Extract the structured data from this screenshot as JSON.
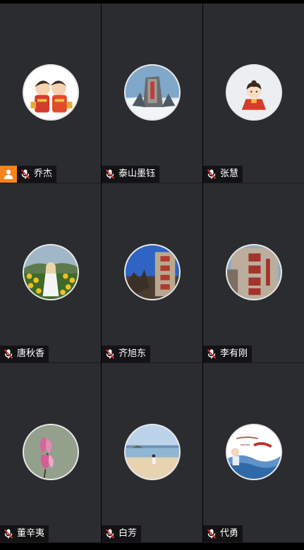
{
  "participants": [
    {
      "name": "乔杰",
      "host": true,
      "avatar": "cartoon-couple"
    },
    {
      "name": "泰山墨钰",
      "host": false,
      "avatar": "mountain-stele"
    },
    {
      "name": "张慧",
      "host": false,
      "avatar": "cartoon-girl"
    },
    {
      "name": "唐秋香",
      "host": false,
      "avatar": "sunflower-field"
    },
    {
      "name": "齐旭东",
      "host": false,
      "avatar": "stone-inscription"
    },
    {
      "name": "李有刚",
      "host": false,
      "avatar": "stone-inscription-close"
    },
    {
      "name": "董辛夷",
      "host": false,
      "avatar": "magnolia-flower"
    },
    {
      "name": "白芳",
      "host": false,
      "avatar": "beach"
    },
    {
      "name": "代勇",
      "host": false,
      "avatar": "sea-calligraphy"
    }
  ],
  "colors": {
    "tile_bg": "#2b2c2f",
    "host_badge": "#f5841f",
    "mic_muted": "#e0312f",
    "label_text": "#ffffff"
  },
  "icons": {
    "host": "person-icon",
    "mic": "mic-muted-icon"
  }
}
